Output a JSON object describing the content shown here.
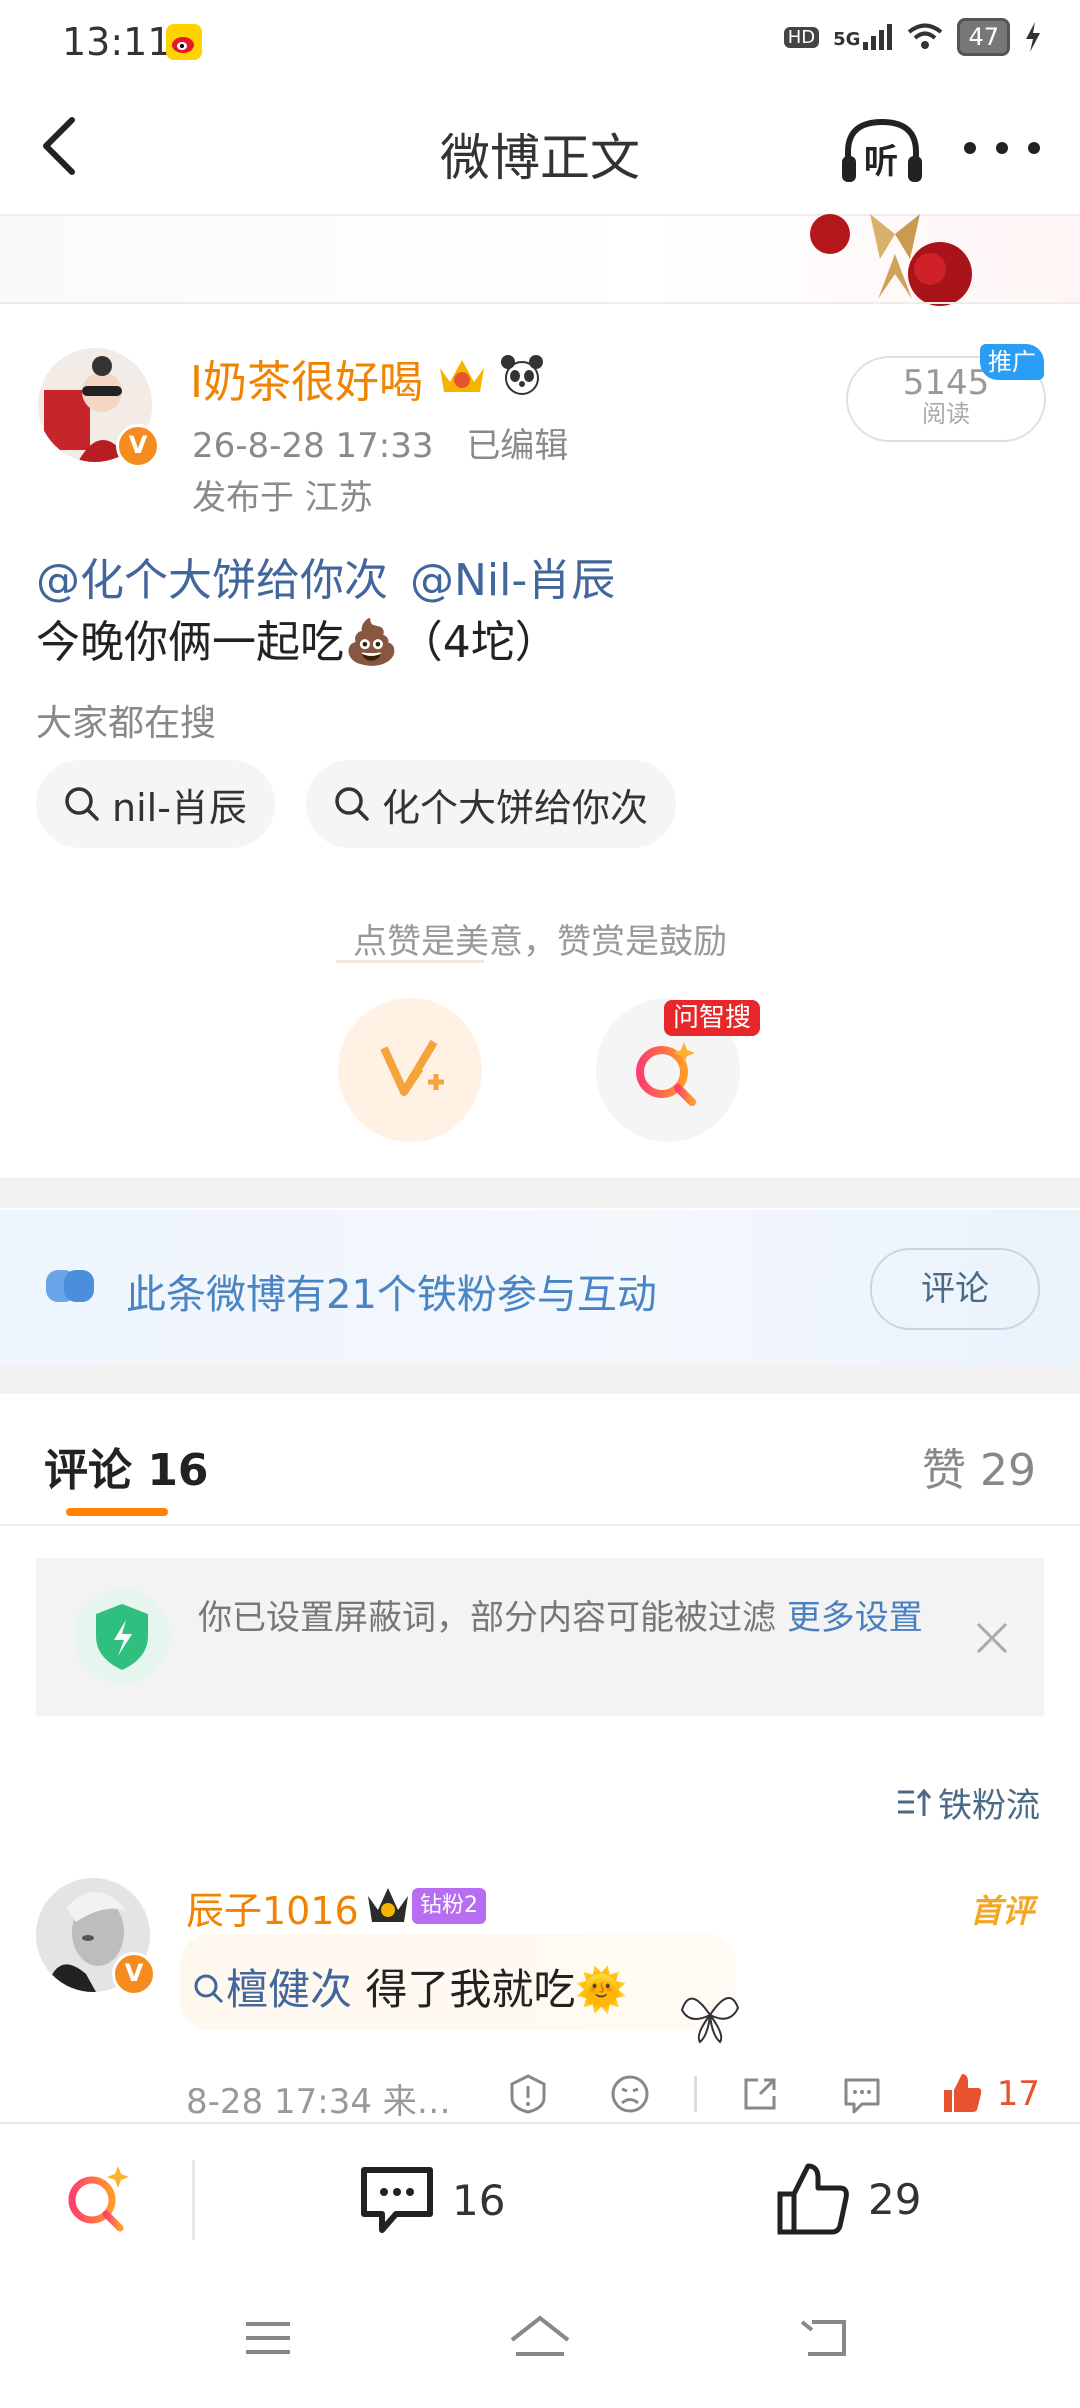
{
  "status_bar": {
    "time": "13:11",
    "network": "5G",
    "hd": "HD",
    "battery": "47"
  },
  "nav": {
    "title": "微博正文",
    "listen_label": "听"
  },
  "post": {
    "author": "I奶茶很好喝",
    "verified_badge": "V",
    "timestamp": "26-8-28 17:33",
    "edited": "已编辑",
    "location": "发布于 江苏",
    "reads_count": "5145",
    "reads_label": "阅读",
    "promo_tag": "推广",
    "mention_1": "@化个大饼给你次",
    "mention_2": "@Nil-肖辰",
    "body_text": "今晚你俩一起吃💩（4坨）"
  },
  "search_suggestions": {
    "heading": "大家都在搜",
    "items": [
      "nil-肖辰",
      "化个大饼给你次"
    ]
  },
  "reward": {
    "note": "点赞是美意，赞赏是鼓励",
    "wzs_tag": "问智搜"
  },
  "fan_banner": {
    "text": "此条微博有21个铁粉参与互动",
    "button": "评论"
  },
  "tabs": {
    "comments": "评论 16",
    "likes": "赞 29"
  },
  "notice": {
    "text": "你已设置屏蔽词，部分内容可能被过滤 ",
    "link": "更多设置"
  },
  "sort_label": "铁粉流",
  "comments": [
    {
      "name": "辰子1016",
      "fan_level": "钻粉2",
      "first_tag": "首评",
      "topic": "檀健次",
      "text": " 得了我就吃🌞",
      "meta": "8-28 17:34  来…",
      "likes": "17"
    }
  ],
  "bottom_bar": {
    "comments": "16",
    "likes": "29"
  },
  "colors": {
    "accent": "#ff8200",
    "link": "#41669b",
    "name": "#f08300"
  }
}
